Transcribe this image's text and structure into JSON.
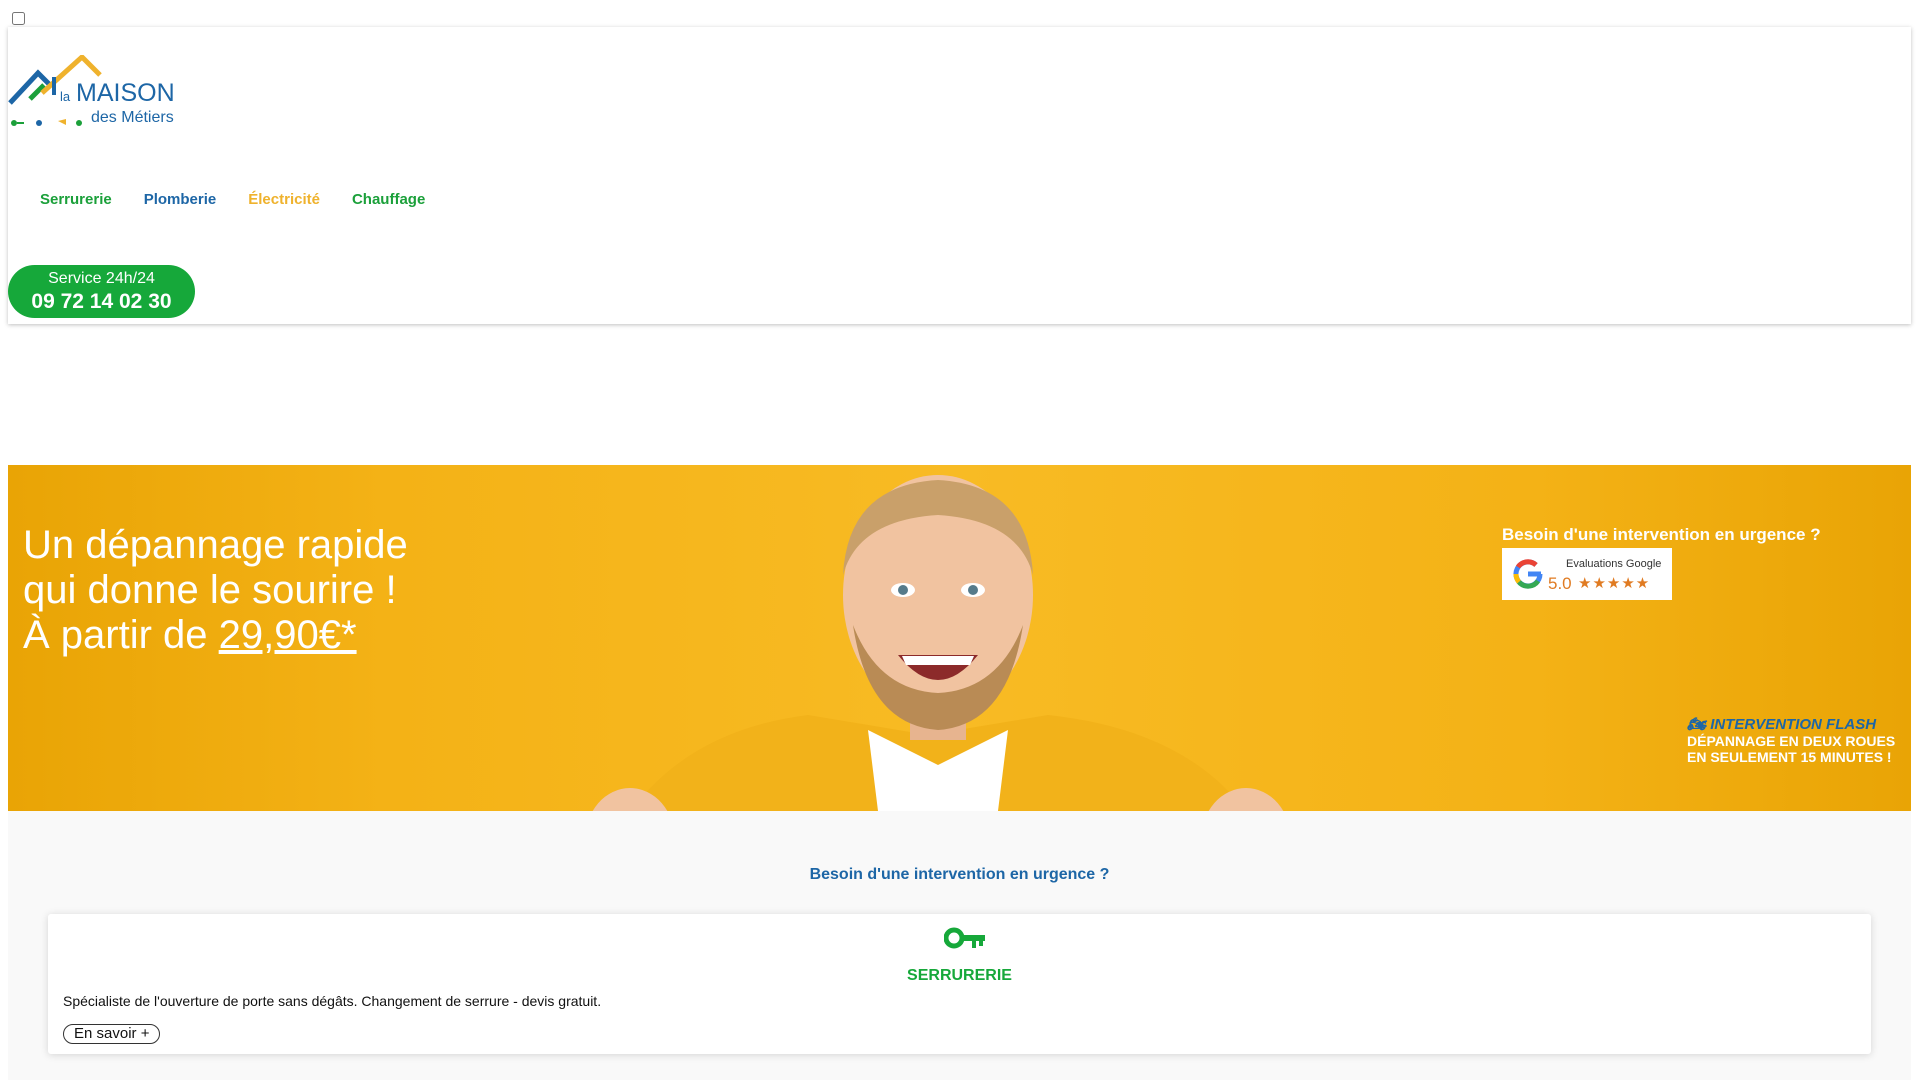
{
  "brand": {
    "logo_small": "la",
    "logo_main": "MAISON",
    "logo_sub": "des Métiers",
    "colors": {
      "green": "#1ba03a",
      "blue": "#1d66a6",
      "yellow": "#efb22d",
      "orange": "#e07b22",
      "hero": "#f4b216"
    }
  },
  "nav": {
    "items": [
      {
        "label": "Serrurerie"
      },
      {
        "label": "Plomberie"
      },
      {
        "label": "Électricité"
      },
      {
        "label": "Chauffage"
      }
    ]
  },
  "phone": {
    "service": "Service 24h/24",
    "number": "09 72 14 02 30"
  },
  "hero": {
    "line1": "Un dépannage rapide",
    "line2": "qui donne le sourire !",
    "line3_prefix": "À partir de ",
    "price": "29,90€*",
    "urgence": "Besoin d'une intervention en urgence ?",
    "google": {
      "title": "Evaluations Google",
      "score": "5.0",
      "stars": 5
    },
    "flash": {
      "icon": "motorbike-icon",
      "title": "INTERVENTION FLASH",
      "line1": "DÉPANNAGE EN DEUX ROUES",
      "line2": "EN SEULEMENT 15 MINUTES !"
    }
  },
  "services": {
    "title": "Besoin d'une intervention en urgence ?",
    "cards": [
      {
        "icon": "key-icon",
        "title": "SERRURERIE",
        "description": "Spécialiste de l'ouverture de porte sans dégâts. Changement de serrure - devis gratuit.",
        "button": "En savoir +"
      }
    ]
  }
}
